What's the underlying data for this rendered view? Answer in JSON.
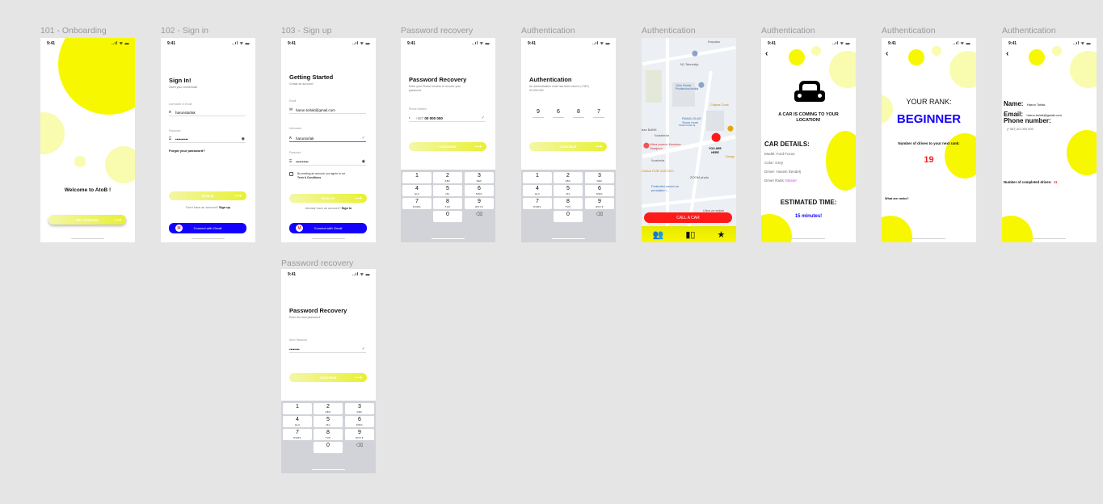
{
  "status": {
    "time": "9:41",
    "signal": "..ıl ᯤ ▬"
  },
  "frames": {
    "onboarding": {
      "label": "101 - Onboarding",
      "welcome": "Welcome to AtoB !",
      "cta": "GET STARTED"
    },
    "signin": {
      "label": "102 - Sign in",
      "title": "Sign In!",
      "subtitle": "Insert your credentials!",
      "username_label": "Username or Email",
      "username_value": "harunstarlak",
      "password_label": "Password",
      "password_value": "••••••••••",
      "forgot": "Forgot your password?",
      "cta": "SIGN IN",
      "no_account": "Don't have an account?",
      "signup_link": "Sign up",
      "gmail": "Connect with Gmail"
    },
    "signup": {
      "label": "103 - Sign up",
      "title": "Getting Started",
      "subtitle": "Create an account!",
      "email_label": "Email",
      "email_value": "harun.torlak@gmail.com",
      "username_label": "Username",
      "username_value": "haruntorlak",
      "password_label": "Password",
      "password_value": "••••••••••",
      "terms": "By creating an account, you agree to our",
      "terms_link": "Term & Conditions",
      "cta": "SIGN UP",
      "have_account": "Already have an account?",
      "signin_link": "Sign In",
      "gmail": "Connect with Gmail"
    },
    "recovery_phone": {
      "label": "Password recovery",
      "title": "Password Recovery",
      "subtitle": "Enter your Phone number to recover your password",
      "phone_label": "Phone Number",
      "phone_prefix": "+387",
      "phone_value": "00 000 000",
      "cta": "CONTINUE"
    },
    "authentication_code": {
      "label": "Authentication",
      "title": "Authentication",
      "subtitle": "An authentication code has been sent to (+387) 00 000 000",
      "digits": [
        "9",
        "6",
        "8",
        "7"
      ],
      "cta": "CONTINUE"
    },
    "authentication_map": {
      "label": "Authentication",
      "you_are_here": "YOU ARE HERE",
      "call": "CALL A CAR",
      "places": [
        "Krupska",
        "N1 Televizija",
        "Ciklo Centar Prodavnica bicikla",
        "Chipas Conc",
        "RAMA-GLAS Show room",
        "Obalni bicikl raj",
        "ban BANK",
        "Hitna pomoć Kantona Sarajevo",
        "Kovačevića",
        "ZOOM photo",
        "Drugo",
        "Centar PUB VIJEČKO",
        "Federalni zavod za penzijsko i...",
        "Kovaačevića",
        "Ulica za sejtan"
      ]
    },
    "authentication_car": {
      "label": "Authentication",
      "coming": "A CAR IS COMING TO YOUR LOCATION!",
      "details_title": "CAR DETAILS:",
      "model": "Model: Ford Focus",
      "color": "Color: Grey",
      "driver": "Driver: Husein Šendelj",
      "rank_label": "Driver Rank:",
      "rank_value": "Master",
      "eta_title": "ESTIMATED TIME:",
      "eta_value": "15 minutes!",
      "accent": "#e040fb"
    },
    "authentication_rank": {
      "label": "Authentication",
      "rank_title": "YOUR RANK:",
      "rank_value": "BEGINNER",
      "next_label": "Number of drives to your next rank:",
      "next_value": "19",
      "ranks_link": "What are ranks?"
    },
    "authentication_profile": {
      "label": "Authentication",
      "name_label": "Name:",
      "name_value": "Harun Torlak",
      "email_label": "Email:",
      "email_value": "harun.torlak@gmail.com",
      "phone_label": "Phone number:",
      "phone_value": "(+387) 61 000 000",
      "completed_label": "Number of completed drives:",
      "completed_value": "11"
    },
    "recovery_new": {
      "label": "Password recovery",
      "title": "Password Recovery",
      "subtitle": "Enter the new password!",
      "password_label": "New Password",
      "password_value": "••••••••",
      "cta": "CONTINUE"
    }
  },
  "keypad": [
    {
      "n": "1",
      "l": ""
    },
    {
      "n": "2",
      "l": "ABC"
    },
    {
      "n": "3",
      "l": "DEF"
    },
    {
      "n": "4",
      "l": "GHI"
    },
    {
      "n": "5",
      "l": "JKL"
    },
    {
      "n": "6",
      "l": "MNO"
    },
    {
      "n": "7",
      "l": "PQRS"
    },
    {
      "n": "8",
      "l": "TUV"
    },
    {
      "n": "9",
      "l": "WXYZ"
    },
    {
      "n": "",
      "l": ""
    },
    {
      "n": "0",
      "l": ""
    },
    {
      "n": "⌫",
      "l": ""
    }
  ],
  "colors": {
    "yellow": "#f7f700",
    "pale_yellow": "#f9fbae",
    "blue": "#1400ff",
    "red": "#ff1a1a"
  }
}
